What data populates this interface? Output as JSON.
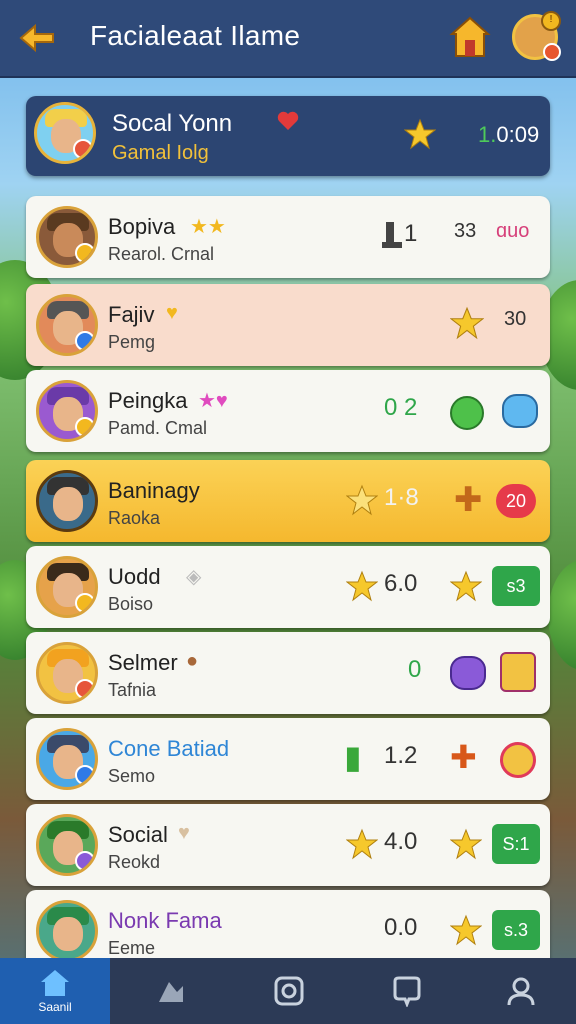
{
  "header": {
    "title": "Facialeaat Ilame",
    "back_icon": "back-arrow-icon",
    "home_icon": "home-icon"
  },
  "me": {
    "name": "Socal Yonn",
    "sub": "Gamal Iolg",
    "time_green": "1.",
    "time_rest": "0:09"
  },
  "rows": [
    {
      "name": "Bopiva",
      "sub": "Rearol. Crnal",
      "a": "1",
      "b": "33",
      "c": "ɑuo"
    },
    {
      "name": "Fajiv",
      "sub": "Pemg",
      "a": "",
      "b": "30",
      "c": ""
    },
    {
      "name": "Peingka",
      "sub": "Pamd. Cmal",
      "a": "0 2",
      "b": "",
      "c": ""
    },
    {
      "name": "Baninagy",
      "sub": "Raoka",
      "a": "1·8",
      "b": "",
      "c": "20"
    },
    {
      "name": "Uodd",
      "sub": "Boiso",
      "a": "6.0",
      "b": "",
      "c": "s3"
    },
    {
      "name": "Selmer",
      "sub": "Tafnia",
      "a": "0",
      "b": "",
      "c": ""
    },
    {
      "name": "Cone Batiad",
      "sub": "Semo",
      "a": "1.2",
      "b": "",
      "c": ""
    },
    {
      "name": "Social",
      "sub": "Reokd",
      "a": "4.0",
      "b": "",
      "c": "S:1"
    },
    {
      "name": "Nonk Fama",
      "sub": "Eeme",
      "a": "0.0",
      "b": "",
      "c": "s.3"
    }
  ],
  "nav": {
    "home_label": "Saanil"
  },
  "colors": {
    "header": "#2f4a79",
    "accent": "#1f5fb0",
    "green_pill": "#2fa64a",
    "gold_row": "#f5b82e"
  }
}
